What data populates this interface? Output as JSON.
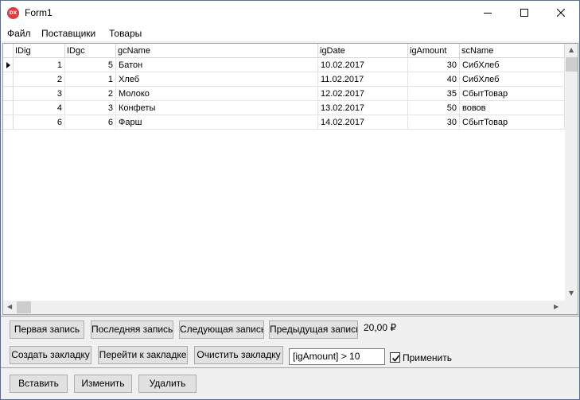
{
  "window": {
    "title": "Form1",
    "icon_text": "DX"
  },
  "menu": {
    "items": [
      "Файл",
      "Поставщики",
      "Товары"
    ]
  },
  "grid": {
    "columns": [
      "IDig",
      "IDgc",
      "gcName",
      "igDate",
      "igAmount",
      "scName"
    ],
    "rows": [
      [
        "1",
        "5",
        "Батон",
        "10.02.2017",
        "30",
        "СибХлеб"
      ],
      [
        "2",
        "1",
        "Хлеб",
        "11.02.2017",
        "40",
        "СибХлеб"
      ],
      [
        "3",
        "2",
        "Молоко",
        "12.02.2017",
        "35",
        "СбытТовар"
      ],
      [
        "4",
        "3",
        "Конфеты",
        "13.02.2017",
        "50",
        "вовов"
      ],
      [
        "6",
        "6",
        "Фарш",
        "14.02.2017",
        "30",
        "СбытТовар"
      ]
    ]
  },
  "nav": {
    "first": "Первая запись",
    "last": "Последняя запись",
    "next": "Следующая запись",
    "prev": "Предыдущая запись",
    "price": "20,00 ₽"
  },
  "bookmarks": {
    "create": "Создать закладку",
    "goto": "Перейти к закладке",
    "clear": "Очистить закладку"
  },
  "filter": {
    "value": "[igAmount] > 10",
    "apply_label": "Применить",
    "apply_checked": true
  },
  "actions": {
    "insert": "Вставить",
    "edit": "Изменить",
    "delete": "Удалить"
  }
}
